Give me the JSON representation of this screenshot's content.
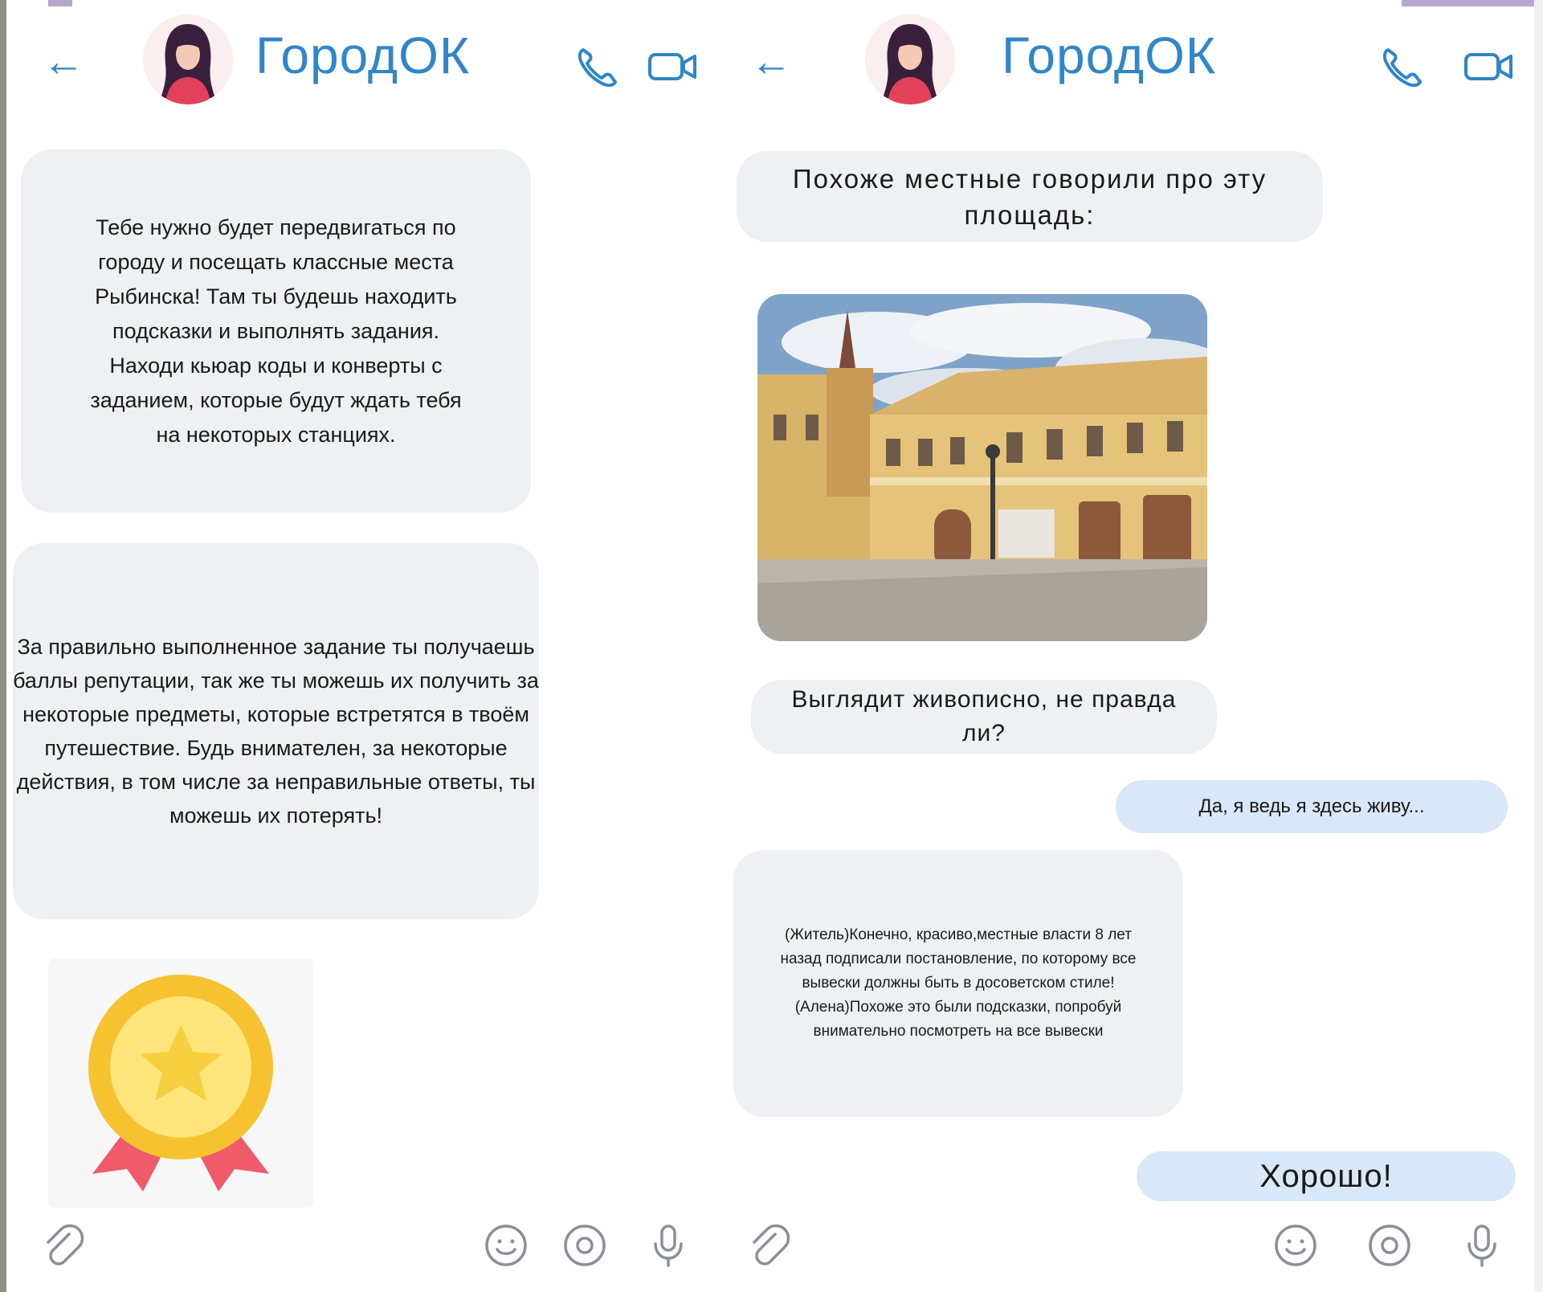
{
  "chat": {
    "title": "ГородОК"
  },
  "left_panel": {
    "messages": [
      "Тебе нужно будет передвигаться по городу и посещать классные места Рыбинска! Там ты будешь находить подсказки и выполнять задания. Находи кьюар коды и конверты с заданием, которые будут ждать тебя на некоторых станциях.",
      "За правильно выполненное задание ты получаешь баллы репутации, так же ты можешь их получить за некоторые предметы, которые встретятся в твоём путешествие. Будь внимателен, за некоторые действия, в том числе за неправильные ответы, ты можешь их потерять!"
    ]
  },
  "right_panel": {
    "messages": [
      "Похоже местные говорили про эту площадь:",
      "Выглядит живописно, не правда ли?",
      "Да, я ведь я здесь живу...",
      "(Житель)Конечно, красиво,местные власти 8 лет назад подписали постановление, по которому все вывески должны быть в досоветском стиле! (Алена)Похоже это были подсказки, попробуй внимательно посмотреть на все вывески",
      "Хорошо!"
    ]
  },
  "colors": {
    "accent": "#2f86c8",
    "incoming_bubble": "#eef0f4",
    "outgoing_bubble": "#d8e8f8"
  }
}
